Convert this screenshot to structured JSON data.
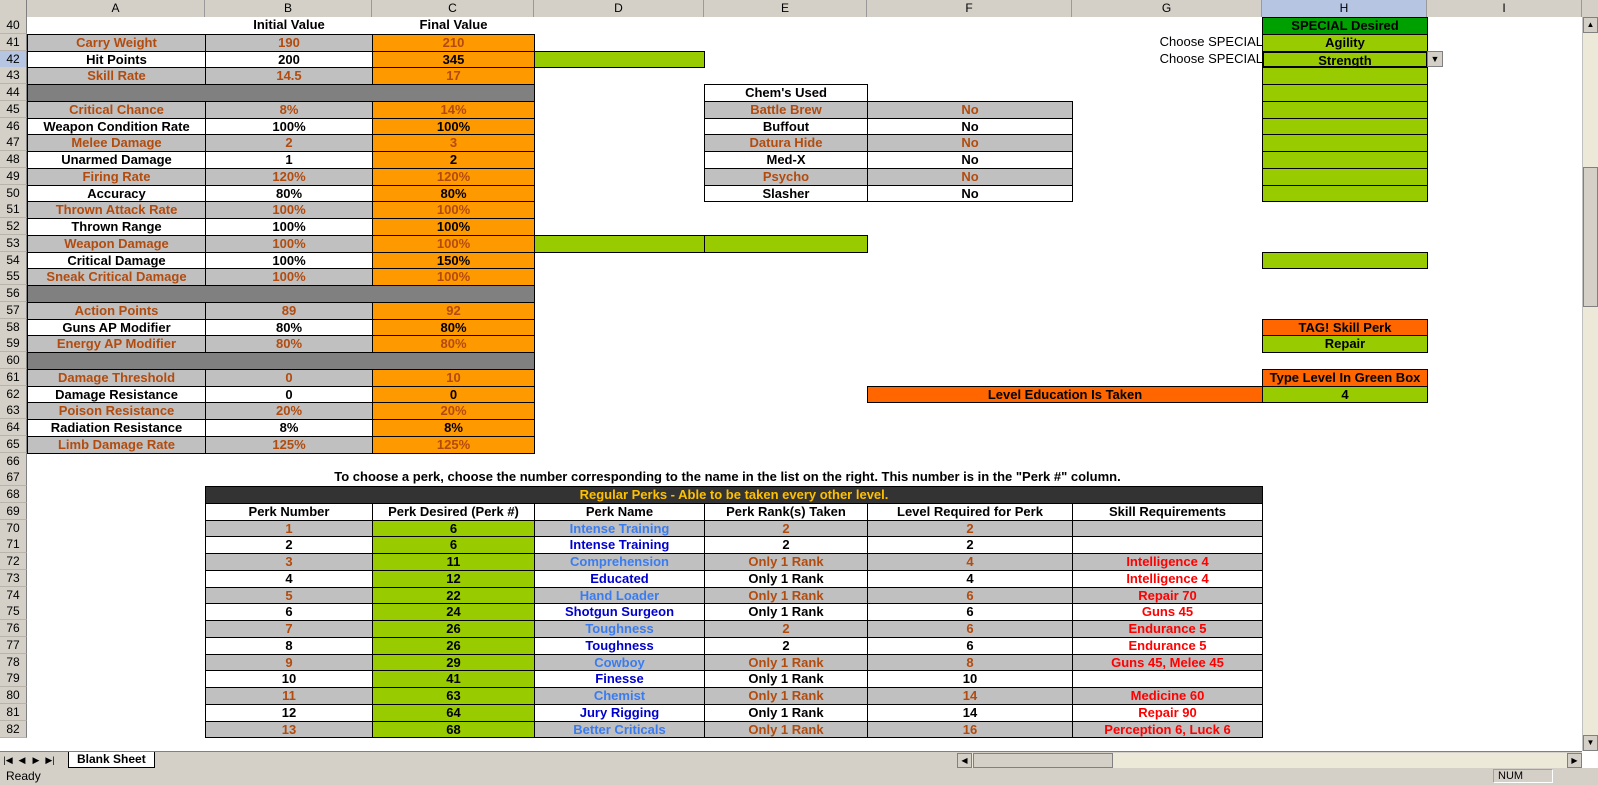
{
  "columns": [
    "A",
    "B",
    "C",
    "D",
    "E",
    "F",
    "G",
    "H",
    "I"
  ],
  "selected_column": "H",
  "selected_row": 42,
  "rows": [
    40,
    41,
    42,
    43,
    44,
    45,
    46,
    47,
    48,
    49,
    50,
    51,
    52,
    53,
    54,
    55,
    56,
    57,
    58,
    59,
    60,
    61,
    62,
    63,
    64,
    65,
    66,
    67,
    68,
    69,
    70,
    71,
    72,
    73,
    74,
    75,
    76,
    77,
    78,
    79,
    80,
    81,
    82
  ],
  "stats_headers": {
    "initial": "Initial Value",
    "final": "Final Value"
  },
  "stats": [
    {
      "label": "Carry Weight",
      "initial": "190",
      "final": "210"
    },
    {
      "label": "Hit Points",
      "initial": "200",
      "final": "345"
    },
    {
      "label": "Skill Rate",
      "initial": "14.5",
      "final": "17"
    },
    null,
    {
      "label": "Critical Chance",
      "initial": "8%",
      "final": "14%"
    },
    {
      "label": "Weapon Condition Rate",
      "initial": "100%",
      "final": "100%"
    },
    {
      "label": "Melee Damage",
      "initial": "2",
      "final": "3"
    },
    {
      "label": "Unarmed Damage",
      "initial": "1",
      "final": "2"
    },
    {
      "label": "Firing Rate",
      "initial": "120%",
      "final": "120%"
    },
    {
      "label": "Accuracy",
      "initial": "80%",
      "final": "80%"
    },
    {
      "label": "Thrown Attack Rate",
      "initial": "100%",
      "final": "100%"
    },
    {
      "label": "Thrown Range",
      "initial": "100%",
      "final": "100%"
    },
    {
      "label": "Weapon Damage",
      "initial": "100%",
      "final": "100%"
    },
    {
      "label": "Critical Damage",
      "initial": "100%",
      "final": "150%"
    },
    {
      "label": "Sneak Critical Damage",
      "initial": "100%",
      "final": "100%"
    },
    null,
    {
      "label": "Action Points",
      "initial": "89",
      "final": "92"
    },
    {
      "label": "Guns AP Modifier",
      "initial": "80%",
      "final": "80%"
    },
    {
      "label": "Energy AP Modifier",
      "initial": "80%",
      "final": "80%"
    },
    null,
    {
      "label": "Damage Threshold",
      "initial": "0",
      "final": "10"
    },
    {
      "label": "Damage Resistance",
      "initial": "0",
      "final": "0"
    },
    {
      "label": "Poison Resistance",
      "initial": "20%",
      "final": "20%"
    },
    {
      "label": "Radiation Resistance",
      "initial": "8%",
      "final": "8%"
    },
    {
      "label": "Limb Damage Rate",
      "initial": "125%",
      "final": "125%"
    }
  ],
  "chems": {
    "header": "Chem's Used",
    "items": [
      {
        "name": "Battle Brew",
        "used": "No"
      },
      {
        "name": "Buffout",
        "used": "No"
      },
      {
        "name": "Datura Hide",
        "used": "No"
      },
      {
        "name": "Med-X",
        "used": "No"
      },
      {
        "name": "Psycho",
        "used": "No"
      },
      {
        "name": "Slasher",
        "used": "No"
      }
    ]
  },
  "special": {
    "header": "SPECIAL Desired",
    "choose_label": "Choose SPECIAL",
    "choice1": "Agility",
    "choice2": "Strength"
  },
  "tag": {
    "header": "TAG! Skill Perk",
    "value": "Repair"
  },
  "education": {
    "type_label": "Type Level In Green Box",
    "label": "Level Education Is Taken",
    "value": "4"
  },
  "perks": {
    "instruction": "To choose a perk, choose the number corresponding to the name in the list on the right. This number is in the \"Perk #\" column.",
    "banner": "Regular Perks - Able to be taken every other level.",
    "headers": [
      "Perk Number",
      "Perk Desired (Perk #)",
      "Perk Name",
      "Perk Rank(s) Taken",
      "Level Required for Perk",
      "Skill Requirements"
    ],
    "rows": [
      [
        "1",
        "6",
        "Intense Training",
        "2",
        "2",
        ""
      ],
      [
        "2",
        "6",
        "Intense Training",
        "2",
        "2",
        ""
      ],
      [
        "3",
        "11",
        "Comprehension",
        "Only 1 Rank",
        "4",
        "Intelligence 4"
      ],
      [
        "4",
        "12",
        "Educated",
        "Only 1 Rank",
        "4",
        "Intelligence 4"
      ],
      [
        "5",
        "22",
        "Hand Loader",
        "Only 1 Rank",
        "6",
        "Repair 70"
      ],
      [
        "6",
        "24",
        "Shotgun Surgeon",
        "Only 1 Rank",
        "6",
        "Guns 45"
      ],
      [
        "7",
        "26",
        "Toughness",
        "2",
        "6",
        "Endurance 5"
      ],
      [
        "8",
        "26",
        "Toughness",
        "2",
        "6",
        "Endurance 5"
      ],
      [
        "9",
        "29",
        "Cowboy",
        "Only 1 Rank",
        "8",
        "Guns 45, Melee 45"
      ],
      [
        "10",
        "41",
        "Finesse",
        "Only 1 Rank",
        "10",
        ""
      ],
      [
        "11",
        "63",
        "Chemist",
        "Only 1 Rank",
        "14",
        "Medicine 60"
      ],
      [
        "12",
        "64",
        "Jury Rigging",
        "Only 1 Rank",
        "14",
        "Repair 90"
      ],
      [
        "13",
        "68",
        "Better Criticals",
        "Only 1 Rank",
        "16",
        "Perception 6, Luck 6"
      ]
    ]
  },
  "sheet_tab": "Blank Sheet",
  "status": {
    "ready": "Ready",
    "num": "NUM"
  }
}
